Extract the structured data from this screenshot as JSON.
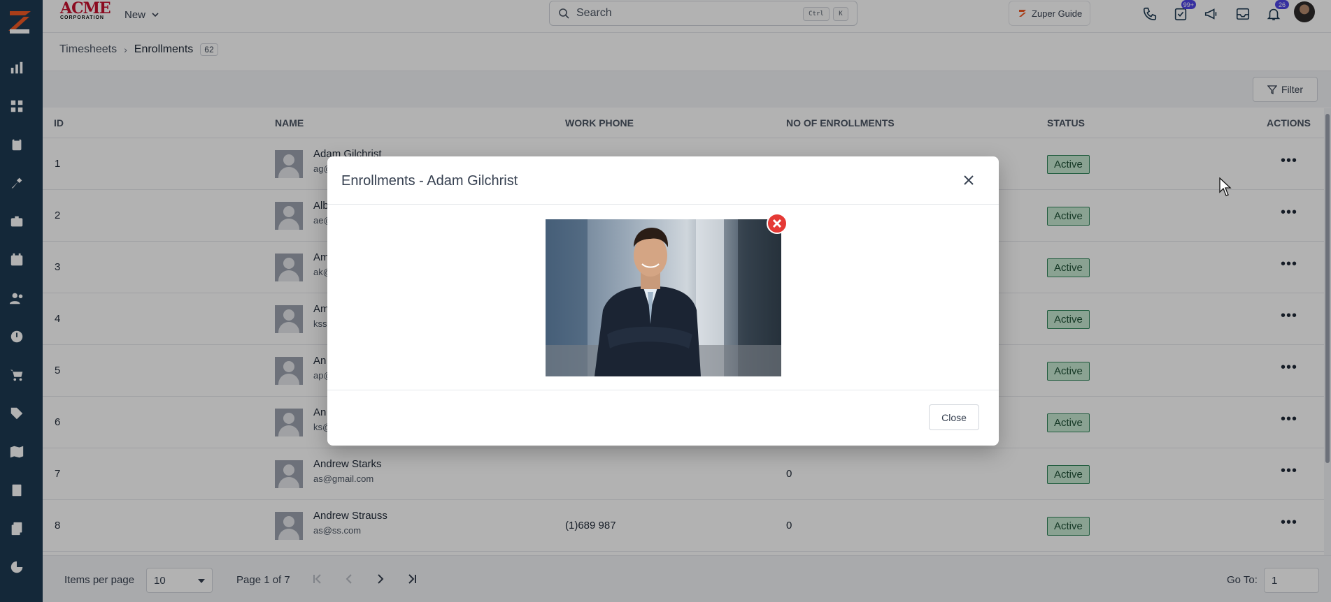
{
  "brand": {
    "name": "ACME",
    "subtitle": "CORPORATION"
  },
  "header": {
    "new_label": "New",
    "search_placeholder": "Search",
    "shortcut_keys": [
      "Ctrl",
      "K"
    ],
    "guide_label": "Zuper Guide",
    "tasks_badge": "99+",
    "notifications_badge": "26"
  },
  "breadcrumb": {
    "parent": "Timesheets",
    "current": "Enrollments",
    "count": "62"
  },
  "toolbar": {
    "filter_label": "Filter"
  },
  "table": {
    "columns": [
      "ID",
      "NAME",
      "WORK PHONE",
      "NO OF ENROLLMENTS",
      "STATUS",
      "ACTIONS"
    ],
    "rows": [
      {
        "id": "1",
        "name": "Adam Gilchrist",
        "email": "ag@",
        "phone": "",
        "enrollments": "",
        "status": "Active"
      },
      {
        "id": "2",
        "name": "Alb",
        "email": "ae@",
        "phone": "",
        "enrollments": "",
        "status": "Active"
      },
      {
        "id": "3",
        "name": "Am",
        "email": "ak@",
        "phone": "",
        "enrollments": "",
        "status": "Active"
      },
      {
        "id": "4",
        "name": "Am",
        "email": "kss",
        "phone": "",
        "enrollments": "",
        "status": "Active"
      },
      {
        "id": "5",
        "name": "An",
        "email": "ap@",
        "phone": "",
        "enrollments": "",
        "status": "Active"
      },
      {
        "id": "6",
        "name": "An",
        "email": "ks@",
        "phone": "",
        "enrollments": "",
        "status": "Active"
      },
      {
        "id": "7",
        "name": "Andrew Starks",
        "email": "as@gmail.com",
        "phone": "",
        "enrollments": "0",
        "status": "Active"
      },
      {
        "id": "8",
        "name": "Andrew Strauss",
        "email": "as@ss.com",
        "phone": "(1)689 987",
        "enrollments": "0",
        "status": "Active"
      }
    ]
  },
  "pagination": {
    "items_per_page_label": "Items per page",
    "items_per_page_value": "10",
    "page_info": "Page 1 of 7",
    "goto_label": "Go To:",
    "goto_value": "1"
  },
  "modal": {
    "title": "Enrollments - Adam Gilchrist",
    "close_button": "Close"
  },
  "colors": {
    "sidebar": "#1e3a52",
    "status_bg": "#c6e8d2",
    "status_border": "#2f855a",
    "badge": "#4f46e5",
    "remove": "#e53935",
    "brand_red": "#c8102e"
  },
  "icons": {
    "sidebar": [
      "zuper-logo-icon",
      "dashboard-icon",
      "grid-icon",
      "jobs-icon",
      "tools-icon",
      "briefcase-icon",
      "calendar-icon",
      "users-icon",
      "clock-icon",
      "cart-icon",
      "tag-icon",
      "map-icon",
      "invoice-icon",
      "documents-icon",
      "pie-chart-icon"
    ],
    "topbar": [
      "phone-icon",
      "tasks-icon",
      "megaphone-icon",
      "inbox-icon",
      "bell-icon"
    ]
  }
}
